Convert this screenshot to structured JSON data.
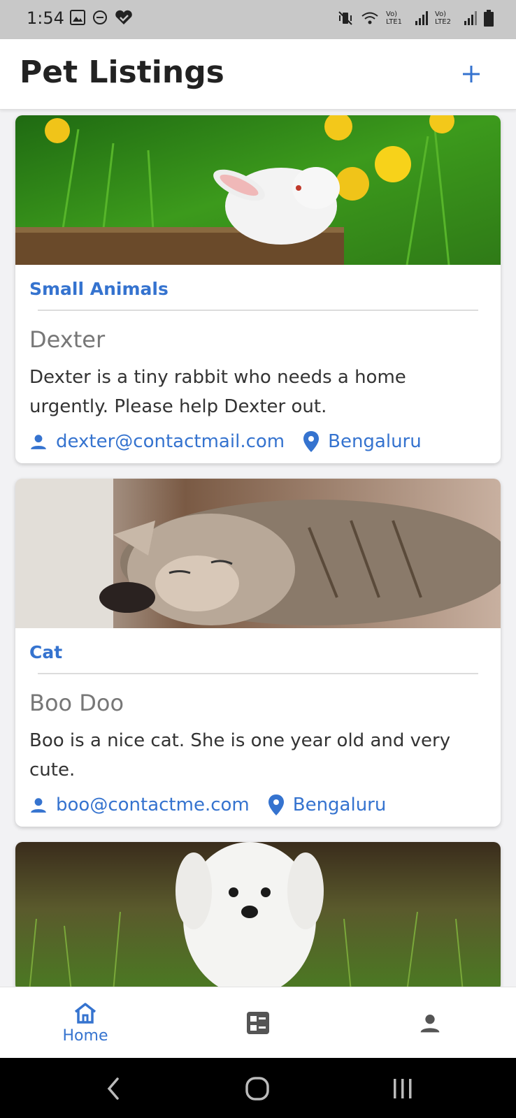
{
  "status": {
    "time": "1:54",
    "sim1": "Vo) LTE1",
    "sim2": "Vo) LTE2"
  },
  "header": {
    "title": "Pet Listings"
  },
  "listings": [
    {
      "category": "Small Animals",
      "name": "Dexter",
      "description": "Dexter is a tiny rabbit who needs a home urgently. Please help Dexter out.",
      "email": "dexter@contactmail.com",
      "location": "Bengaluru"
    },
    {
      "category": "Cat",
      "name": "Boo Doo",
      "description": "Boo is a nice cat. She is one year old and very cute.",
      "email": "boo@contactme.com",
      "location": "Bengaluru"
    }
  ],
  "nav": {
    "home_label": "Home"
  },
  "colors": {
    "accent": "#3573cf",
    "bar": "#c8c8c8"
  }
}
